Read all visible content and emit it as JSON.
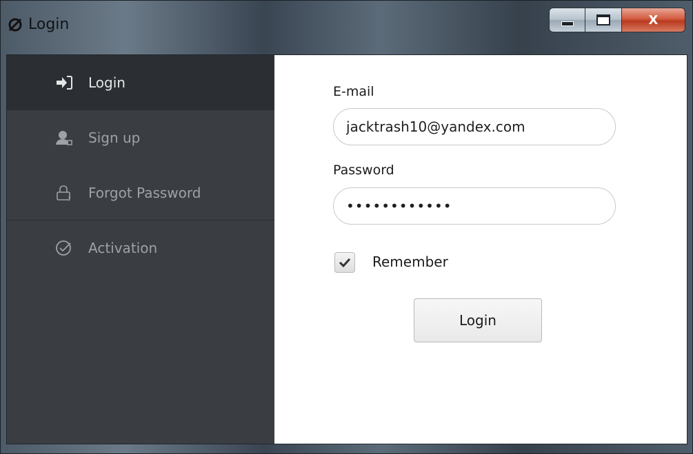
{
  "window": {
    "title": "Login",
    "controls": {
      "close_label": "X"
    }
  },
  "sidebar": {
    "items": [
      {
        "label": "Login",
        "icon": "sign-in-icon",
        "active": true
      },
      {
        "label": "Sign up",
        "icon": "user-add-icon",
        "active": false
      },
      {
        "label": "Forgot Password",
        "icon": "lock-question-icon",
        "active": false
      },
      {
        "label": "Activation",
        "icon": "check-circle-icon",
        "active": false
      }
    ]
  },
  "form": {
    "email_label": "E-mail",
    "email_value": "jacktrash10@yandex.com",
    "password_label": "Password",
    "password_value": "••••••••••••",
    "remember_label": "Remember",
    "remember_checked": true,
    "login_button": "Login"
  },
  "colors": {
    "sidebar_bg": "#3a3e42",
    "sidebar_active_bg": "#2b2f33",
    "main_bg": "#ffffff",
    "close_button": "#c9492c"
  }
}
